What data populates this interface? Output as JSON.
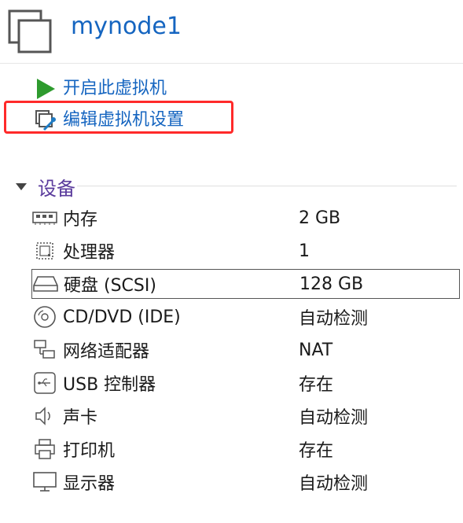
{
  "vm": {
    "name": "mynode1"
  },
  "actions": [
    {
      "label": "开启此虚拟机",
      "icon": "play-icon"
    },
    {
      "label": "编辑虚拟机设置",
      "icon": "edit-settings-icon"
    }
  ],
  "devices_section": {
    "title": "设备"
  },
  "devices": [
    {
      "name": "内存",
      "value": "2 GB",
      "icon": "memory-icon"
    },
    {
      "name": "处理器",
      "value": "1",
      "icon": "processor-icon"
    },
    {
      "name": "硬盘 (SCSI)",
      "value": "128 GB",
      "icon": "hard-disk-icon"
    },
    {
      "name": "CD/DVD (IDE)",
      "value": "自动检测",
      "icon": "cd-dvd-icon"
    },
    {
      "name": "网络适配器",
      "value": "NAT",
      "icon": "network-adapter-icon"
    },
    {
      "name": "USB 控制器",
      "value": "存在",
      "icon": "usb-icon"
    },
    {
      "name": "声卡",
      "value": "自动检测",
      "icon": "speaker-icon"
    },
    {
      "name": "打印机",
      "value": "存在",
      "icon": "printer-icon"
    },
    {
      "name": "显示器",
      "value": "自动检测",
      "icon": "monitor-icon"
    }
  ],
  "colors": {
    "title": "#1565c0",
    "action_link": "#1565c0",
    "play": "#2e9b2e",
    "section": "#5a3b9c",
    "highlight": "#ff2a2a"
  }
}
